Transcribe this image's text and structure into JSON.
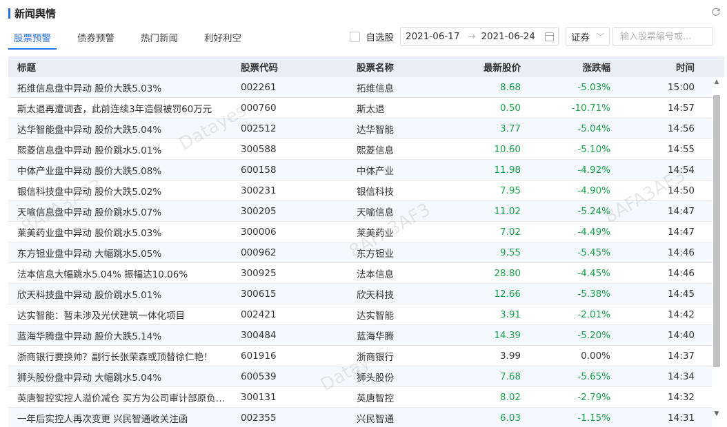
{
  "header": {
    "title": "新闻舆情",
    "refresh_icon": "refresh-icon"
  },
  "tabs": [
    {
      "label": "股票预警",
      "active": true
    },
    {
      "label": "债券预警",
      "active": false
    },
    {
      "label": "热门新闻",
      "active": false
    },
    {
      "label": "利好利空",
      "active": false
    }
  ],
  "filters": {
    "watchlist_label": "自选股",
    "watchlist_checked": false,
    "date_start": "2021-06-17",
    "date_end": "2021-06-24",
    "security_type": "证券",
    "search_placeholder": "输入股票编号或..."
  },
  "table": {
    "columns": [
      "标题",
      "股票代码",
      "股票名称",
      "最新股价",
      "涨跌幅",
      "时间"
    ],
    "rows": [
      {
        "title": "拓维信息盘中异动 股价大跌5.03%",
        "code": "002261",
        "name": "拓维信息",
        "price": "8.68",
        "change": "-5.03%",
        "time": "15:00"
      },
      {
        "title": "斯太退再遭调查，此前连续3年造假被罚60万元",
        "code": "000760",
        "name": "斯太退",
        "price": "0.50",
        "change": "-10.71%",
        "time": "14:57"
      },
      {
        "title": "达华智能盘中异动 股价大跌5.04%",
        "code": "002512",
        "name": "达华智能",
        "price": "3.77",
        "change": "-5.04%",
        "time": "14:56"
      },
      {
        "title": "熙菱信息盘中异动 股价跳水5.01%",
        "code": "300588",
        "name": "熙菱信息",
        "price": "10.60",
        "change": "-5.10%",
        "time": "14:55"
      },
      {
        "title": "中体产业盘中异动 股价大跌5.08%",
        "code": "600158",
        "name": "中体产业",
        "price": "11.98",
        "change": "-4.92%",
        "time": "14:54"
      },
      {
        "title": "银信科技盘中异动 股价大跌5.02%",
        "code": "300231",
        "name": "银信科技",
        "price": "7.95",
        "change": "-4.90%",
        "time": "14:50"
      },
      {
        "title": "天喻信息盘中异动 股价跳水5.07%",
        "code": "300205",
        "name": "天喻信息",
        "price": "11.02",
        "change": "-5.24%",
        "time": "14:47"
      },
      {
        "title": "莱美药业盘中异动 股价跳水5.03%",
        "code": "300006",
        "name": "莱美药业",
        "price": "7.02",
        "change": "-4.49%",
        "time": "14:47"
      },
      {
        "title": "东方钽业盘中异动 大幅跳水5.05%",
        "code": "000962",
        "name": "东方钽业",
        "price": "9.55",
        "change": "-5.45%",
        "time": "14:46"
      },
      {
        "title": "法本信息大幅跳水5.04% 振幅达10.06%",
        "code": "300925",
        "name": "法本信息",
        "price": "28.80",
        "change": "-4.45%",
        "time": "14:46"
      },
      {
        "title": "欣天科技盘中异动 股价跳水5.01%",
        "code": "300615",
        "name": "欣天科技",
        "price": "12.66",
        "change": "-5.38%",
        "time": "14:45"
      },
      {
        "title": "达实智能：暂未涉及光伏建筑一体化项目",
        "code": "002421",
        "name": "达实智能",
        "price": "3.91",
        "change": "-2.01%",
        "time": "14:42"
      },
      {
        "title": "蓝海华腾盘中异动 股价大跌5.14%",
        "code": "300484",
        "name": "蓝海华腾",
        "price": "14.39",
        "change": "-5.20%",
        "time": "14:40"
      },
      {
        "title": "浙商银行要换帅？副行长张荣森或顶替徐仁艳！",
        "code": "601916",
        "name": "浙商银行",
        "price": "3.99",
        "change": "0.00%",
        "time": "14:37"
      },
      {
        "title": "狮头股份盘中异动 大幅跳水5.04%",
        "code": "600539",
        "name": "狮头股份",
        "price": "7.68",
        "change": "-5.65%",
        "time": "14:34"
      },
      {
        "title": "英唐智控实控人溢价减仓 买方为公司审计部原负责人",
        "code": "300131",
        "name": "英唐智控",
        "price": "8.02",
        "change": "-2.79%",
        "time": "14:32"
      },
      {
        "title": "一年后实控人再次变更 兴民智通收关注函",
        "code": "002355",
        "name": "兴民智通",
        "price": "6.03",
        "change": "-1.15%",
        "time": "14:31"
      }
    ]
  },
  "watermarks": [
    "Datayes",
    "8AFA3AF3",
    "8AFA3AF3",
    "8AFA3AF3",
    "Datayes"
  ],
  "colors": {
    "accent": "#2a6ee8",
    "down": "#17a34a",
    "header_bg": "#e9eef6"
  }
}
